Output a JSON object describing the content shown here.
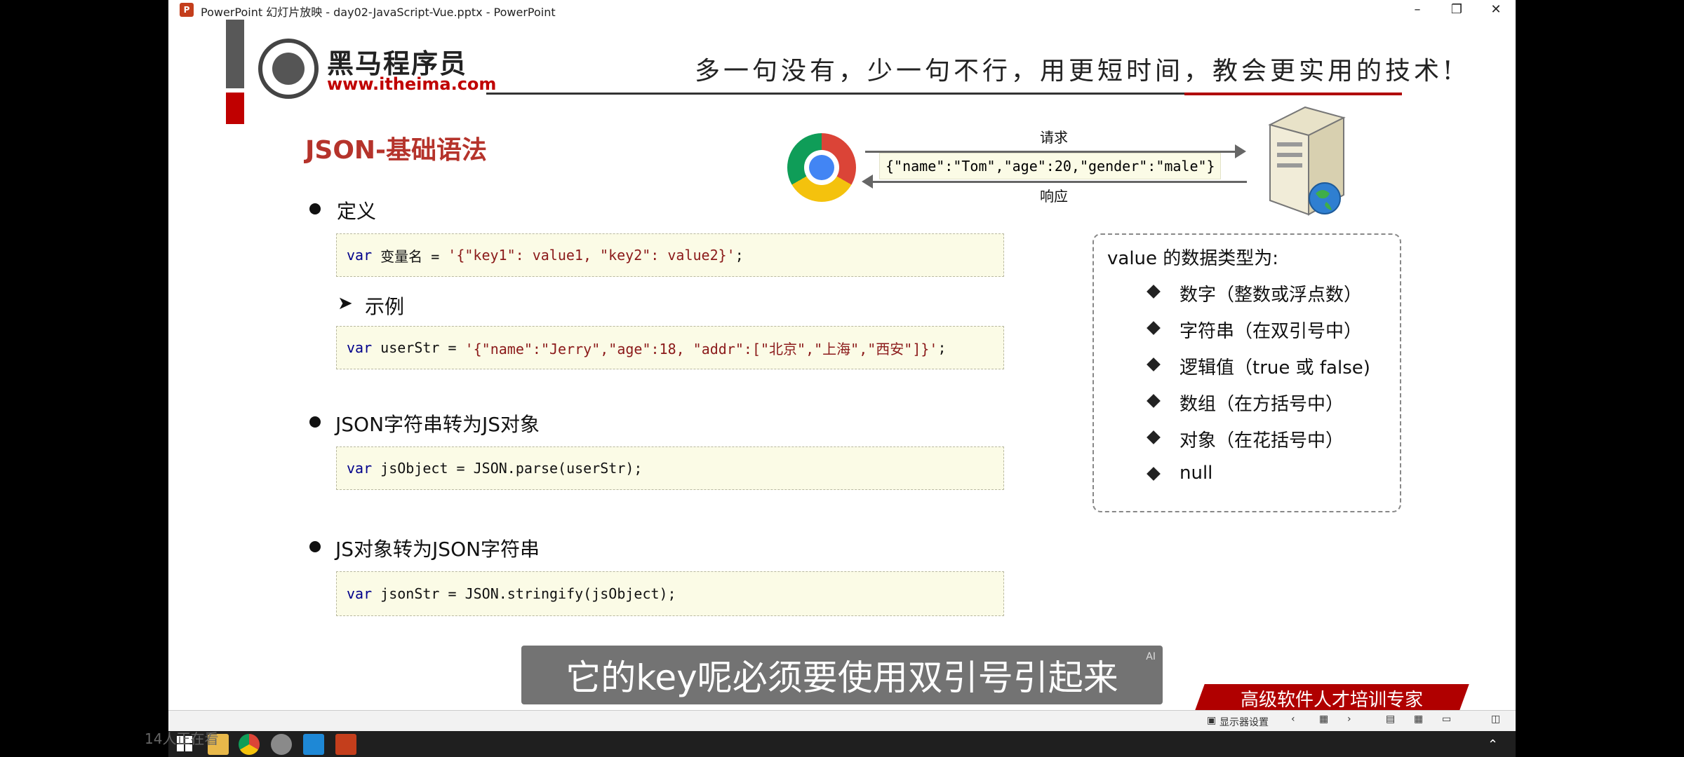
{
  "window": {
    "title": "PowerPoint 幻灯片放映  -  day02-JavaScript-Vue.pptx - PowerPoint",
    "min_icon": "minimize-icon",
    "max_icon": "restore-icon",
    "close_icon": "close-icon"
  },
  "slide": {
    "logo_cn": "黑马程序员",
    "logo_url": "www.itheima.com",
    "slogan": "多一句没有，少一句不行，用更短时间，教会更实用的技术!",
    "title": "JSON-基础语法",
    "diagram": {
      "request_label": "请求",
      "response_label": "响应",
      "json_sample": "{\"name\":\"Tom\",\"age\":20,\"gender\":\"male\"}"
    },
    "sections": [
      {
        "bullet": "定义"
      },
      {
        "bullet": "JSON字符串转为JS对象"
      },
      {
        "bullet": "JS对象转为JSON字符串"
      }
    ],
    "sub_bullet": "示例",
    "code": {
      "def_kw": "var",
      "def_rest": " 变量名 = ",
      "def_str": "'{\"key1\": value1, \"key2\": value2}'",
      "def_end": ";",
      "ex_kw": "var",
      "ex_rest": " userStr = ",
      "ex_str": "'{\"name\":\"Jerry\",\"age\":18, \"addr\":[\"北京\",\"上海\",\"西安\"]}'",
      "ex_end": ";",
      "parse_kw": "var",
      "parse_rest": " jsObject = JSON.parse(userStr);",
      "stringify_kw": "var",
      "stringify_rest": " jsonStr = JSON.stringify(jsObject);"
    },
    "value_box": {
      "heading": "value 的数据类型为:",
      "items": [
        "数字（整数或浮点数）",
        "字符串（在双引号中）",
        "逻辑值（true 或 false)",
        "数组（在方括号中）",
        "对象（在花括号中）",
        "null"
      ]
    },
    "corner_banner": "高级软件人才培训专家"
  },
  "subtitle": {
    "text": "它的key呢必须要使用双引号引起来",
    "badge": "AI"
  },
  "statusbar": {
    "display_settings": "显示器设置"
  },
  "viewers": "14人正在看"
}
